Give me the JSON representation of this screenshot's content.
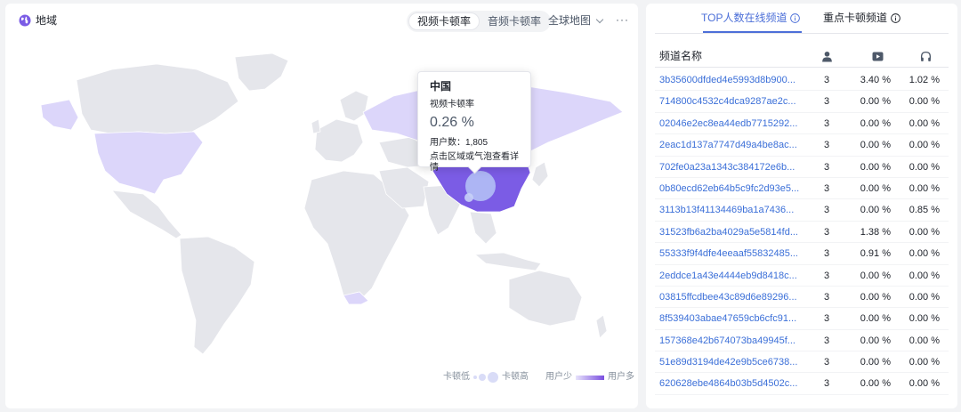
{
  "map": {
    "title": "地域",
    "segments": [
      "视频卡顿率",
      "音频卡顿率"
    ],
    "region_select": "全球地图",
    "more": "···",
    "tooltip": {
      "country": "中国",
      "metric_label": "视频卡顿率",
      "value": "0.26 %",
      "users": "用户数：1,805",
      "hint": "点击区域或气泡查看详情"
    },
    "legend": {
      "stall_low": "卡顿低",
      "stall_high": "卡顿高",
      "users_low": "用户少",
      "users_high": "用户多"
    },
    "colors": {
      "land": "#e5e6eb",
      "light_purple": "#dcd6fa",
      "mid_purple": "#c7bdf5",
      "china": "#7b5ce5",
      "bubble": "#a9b6f2"
    }
  },
  "channels": {
    "tabs": [
      {
        "label": "TOP人数在线频道",
        "active": true
      },
      {
        "label": "重点卡顿频道",
        "active": false
      }
    ],
    "header": {
      "name": "频道名称",
      "users_icon": "user-icon",
      "video_icon": "video-icon",
      "audio_icon": "headphones-icon"
    },
    "rows": [
      {
        "name": "3b35600dfded4e5993d8b900...",
        "users": "3",
        "video": "3.40 %",
        "audio": "1.02 %"
      },
      {
        "name": "714800c4532c4dca9287ae2c...",
        "users": "3",
        "video": "0.00 %",
        "audio": "0.00 %"
      },
      {
        "name": "02046e2ec8ea44edb7715292...",
        "users": "3",
        "video": "0.00 %",
        "audio": "0.00 %"
      },
      {
        "name": "2eac1d137a7747d49a4be8ac...",
        "users": "3",
        "video": "0.00 %",
        "audio": "0.00 %"
      },
      {
        "name": "702fe0a23a1343c384172e6b...",
        "users": "3",
        "video": "0.00 %",
        "audio": "0.00 %"
      },
      {
        "name": "0b80ecd62eb64b5c9fc2d93e5...",
        "users": "3",
        "video": "0.00 %",
        "audio": "0.00 %"
      },
      {
        "name": "3113b13f41134469ba1a7436...",
        "users": "3",
        "video": "0.00 %",
        "audio": "0.85 %"
      },
      {
        "name": "31523fb6a2ba4029a5e5814fd...",
        "users": "3",
        "video": "1.38 %",
        "audio": "0.00 %"
      },
      {
        "name": "55333f9f4dfe4eeaaf55832485...",
        "users": "3",
        "video": "0.91 %",
        "audio": "0.00 %"
      },
      {
        "name": "2eddce1a43e4444eb9d8418c...",
        "users": "3",
        "video": "0.00 %",
        "audio": "0.00 %"
      },
      {
        "name": "03815ffcdbee43c89d6e89296...",
        "users": "3",
        "video": "0.00 %",
        "audio": "0.00 %"
      },
      {
        "name": "8f539403abae47659cb6cfc91...",
        "users": "3",
        "video": "0.00 %",
        "audio": "0.00 %"
      },
      {
        "name": "157368e42b674073ba49945f...",
        "users": "3",
        "video": "0.00 %",
        "audio": "0.00 %"
      },
      {
        "name": "51e89d3194de42e9b5ce6738...",
        "users": "3",
        "video": "0.00 %",
        "audio": "0.00 %"
      },
      {
        "name": "620628ebe4864b03b5d4502c...",
        "users": "3",
        "video": "0.00 %",
        "audio": "0.00 %"
      }
    ]
  }
}
